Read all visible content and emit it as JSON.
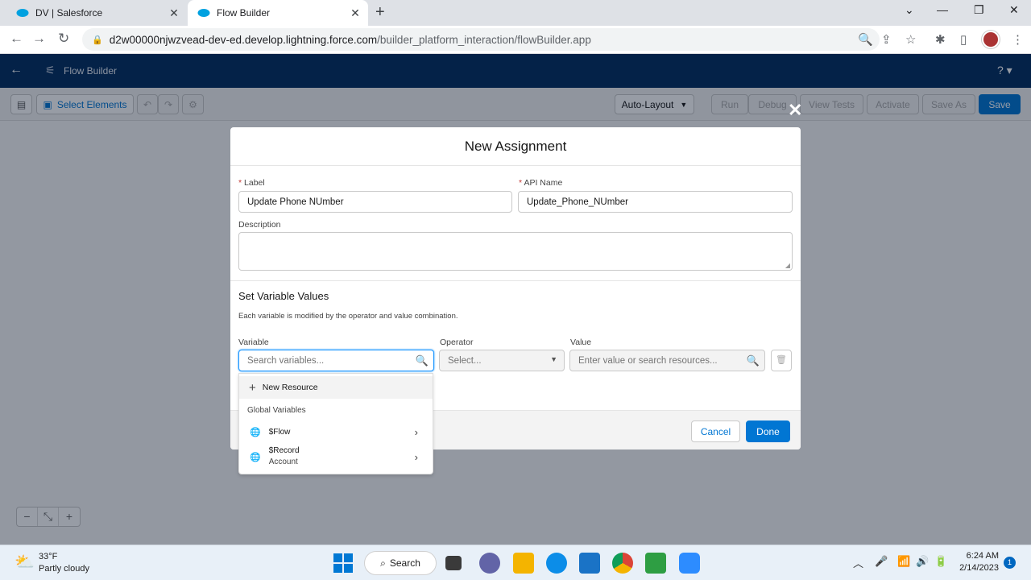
{
  "browser": {
    "tabs": [
      {
        "title": "DV | Salesforce",
        "close": "✕"
      },
      {
        "title": "Flow Builder",
        "close": "✕"
      }
    ],
    "url_host": "d2w00000njwzvead-dev-ed.develop.lightning.force.com",
    "url_path": "/builder_platform_interaction/flowBuilder.app"
  },
  "app": {
    "title": "Flow Builder",
    "help": "? ▾"
  },
  "toolbar": {
    "select_elements": "Select Elements",
    "auto_layout": "Auto-Layout",
    "run": "Run",
    "debug": "Debug",
    "view_tests": "View Tests",
    "activate": "Activate",
    "save_as": "Save As",
    "save": "Save"
  },
  "modal": {
    "title": "New Assignment",
    "label_label": "Label",
    "label_value": "Update Phone NUmber",
    "api_label": "API Name",
    "api_value": "Update_Phone_NUmber",
    "description_label": "Description",
    "section_title": "Set Variable Values",
    "section_desc": "Each variable is modified by the operator and value combination.",
    "variable_label": "Variable",
    "variable_placeholder": "Search variables...",
    "operator_label": "Operator",
    "operator_placeholder": "Select...",
    "value_label": "Value",
    "value_placeholder": "Enter value or search resources...",
    "cancel": "Cancel",
    "done": "Done"
  },
  "dropdown": {
    "new_resource": "New Resource",
    "group": "Global Variables",
    "items": [
      {
        "line1": "$Flow",
        "line2": ""
      },
      {
        "line1": "$Record",
        "line2": "Account"
      }
    ]
  },
  "taskbar": {
    "temperature": "33°F",
    "condition": "Partly cloudy",
    "search": "Search",
    "time": "6:24 AM",
    "date": "2/14/2023",
    "notifications": "1"
  },
  "colors": {
    "sf_header": "#032d60",
    "brand": "#0176d3"
  }
}
